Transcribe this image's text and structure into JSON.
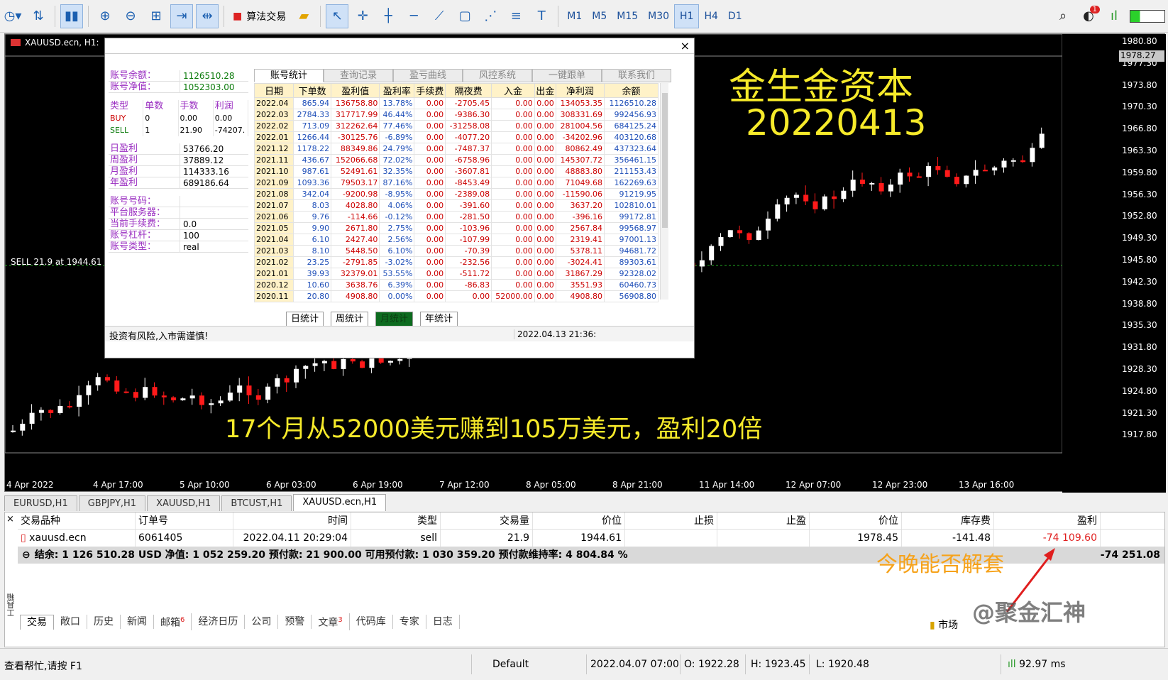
{
  "toolbar": {
    "algo_trading": "算法交易",
    "timeframes": [
      "M1",
      "M5",
      "M15",
      "M30",
      "H1",
      "H4",
      "D1"
    ],
    "active_timeframe": "H1",
    "notification_badge": "1"
  },
  "chart": {
    "title": "XAUUSD.ecn, H1:",
    "sell_line_label": "SELL 21.9 at 1944.61",
    "price_box": "1978.27",
    "y_ticks": [
      "1980.80",
      "1977.30",
      "1973.80",
      "1970.30",
      "1966.80",
      "1963.30",
      "1959.80",
      "1956.30",
      "1952.80",
      "1949.30",
      "1945.80",
      "1942.30",
      "1938.80",
      "1935.30",
      "1931.80",
      "1928.30",
      "1924.80",
      "1921.30",
      "1917.80"
    ],
    "x_ticks": [
      "4 Apr 2022",
      "4 Apr 17:00",
      "5 Apr 10:00",
      "6 Apr 03:00",
      "6 Apr 19:00",
      "7 Apr 12:00",
      "8 Apr 05:00",
      "8 Apr 21:00",
      "11 Apr 14:00",
      "12 Apr 07:00",
      "12 Apr 23:00",
      "13 Apr 16:00"
    ],
    "overlay_title": "金生金资本",
    "overlay_date": "20220413",
    "overlay_caption": "17个月从52000美元赚到105万美元，盈利20倍",
    "overlay_question": "今晚能否解套",
    "colors": {
      "bull": "#ffffff",
      "bear": "#ff1a1a",
      "sell_line": "#22aa22",
      "overlay": "#f6ea2a"
    }
  },
  "dialog": {
    "close": "×",
    "left": {
      "balance": {
        "label": "账号余额：",
        "value": "1126510.28"
      },
      "equity": {
        "label": "账号净值：",
        "value": "1052303.00"
      },
      "type_header": [
        "类型",
        "单数",
        "手数",
        "利润"
      ],
      "buy": [
        "BUY",
        "0",
        "0.00",
        "0.00"
      ],
      "sell": [
        "SELL",
        "1",
        "21.90",
        "-74207."
      ],
      "daily": {
        "label": "日盈利",
        "value": "53766.20"
      },
      "weekly": {
        "label": "周盈利",
        "value": "37889.12"
      },
      "monthly": {
        "label": "月盈利",
        "value": "114333.16"
      },
      "yearly": {
        "label": "年盈利",
        "value": "689186.64"
      },
      "acct_no": {
        "label": "账号号码：",
        "value": ""
      },
      "server": {
        "label": "平台服务器：",
        "value": ""
      },
      "fee": {
        "label": "当前手续费：",
        "value": "0.0"
      },
      "leverage": {
        "label": "账号杠杆：",
        "value": "100"
      },
      "acct_type": {
        "label": "账号类型：",
        "value": "real"
      }
    },
    "tabs": [
      "账号统计",
      "查询记录",
      "盈亏曲线",
      "风控系统",
      "一键跟单",
      "联系我们"
    ],
    "columns": [
      "日期",
      "下单数",
      "盈利值",
      "盈利率",
      "手续费",
      "隔夜费",
      "入金",
      "出金",
      "净利润",
      "余额"
    ],
    "rows": [
      [
        "2022.04",
        "865.94",
        "136758.80",
        "13.78%",
        "0.00",
        "-2705.45",
        "0.00",
        "0.00",
        "134053.35",
        "1126510.28"
      ],
      [
        "2022.03",
        "2784.33",
        "317717.99",
        "46.44%",
        "0.00",
        "-9386.30",
        "0.00",
        "0.00",
        "308331.69",
        "992456.93"
      ],
      [
        "2022.02",
        "713.09",
        "312262.64",
        "77.46%",
        "0.00",
        "-31258.08",
        "0.00",
        "0.00",
        "281004.56",
        "684125.24"
      ],
      [
        "2022.01",
        "1266.44",
        "-30125.76",
        "-6.89%",
        "0.00",
        "-4077.20",
        "0.00",
        "0.00",
        "-34202.96",
        "403120.68"
      ],
      [
        "2021.12",
        "1178.22",
        "88349.86",
        "24.79%",
        "0.00",
        "-7487.37",
        "0.00",
        "0.00",
        "80862.49",
        "437323.64"
      ],
      [
        "2021.11",
        "436.67",
        "152066.68",
        "72.02%",
        "0.00",
        "-6758.96",
        "0.00",
        "0.00",
        "145307.72",
        "356461.15"
      ],
      [
        "2021.10",
        "987.61",
        "52491.61",
        "32.35%",
        "0.00",
        "-3607.81",
        "0.00",
        "0.00",
        "48883.80",
        "211153.43"
      ],
      [
        "2021.09",
        "1093.36",
        "79503.17",
        "87.16%",
        "0.00",
        "-8453.49",
        "0.00",
        "0.00",
        "71049.68",
        "162269.63"
      ],
      [
        "2021.08",
        "342.04",
        "-9200.98",
        "-8.95%",
        "0.00",
        "-2389.08",
        "0.00",
        "0.00",
        "-11590.06",
        "91219.95"
      ],
      [
        "2021.07",
        "8.03",
        "4028.80",
        "4.06%",
        "0.00",
        "-391.60",
        "0.00",
        "0.00",
        "3637.20",
        "102810.01"
      ],
      [
        "2021.06",
        "9.76",
        "-114.66",
        "-0.12%",
        "0.00",
        "-281.50",
        "0.00",
        "0.00",
        "-396.16",
        "99172.81"
      ],
      [
        "2021.05",
        "9.90",
        "2671.80",
        "2.75%",
        "0.00",
        "-103.96",
        "0.00",
        "0.00",
        "2567.84",
        "99568.97"
      ],
      [
        "2021.04",
        "6.10",
        "2427.40",
        "2.56%",
        "0.00",
        "-107.99",
        "0.00",
        "0.00",
        "2319.41",
        "97001.13"
      ],
      [
        "2021.03",
        "8.10",
        "5448.50",
        "6.10%",
        "0.00",
        "-70.39",
        "0.00",
        "0.00",
        "5378.11",
        "94681.72"
      ],
      [
        "2021.02",
        "23.25",
        "-2791.85",
        "-3.02%",
        "0.00",
        "-232.56",
        "0.00",
        "0.00",
        "-3024.41",
        "89303.61"
      ],
      [
        "2021.01",
        "39.93",
        "32379.01",
        "53.55%",
        "0.00",
        "-511.72",
        "0.00",
        "0.00",
        "31867.29",
        "92328.02"
      ],
      [
        "2020.12",
        "10.60",
        "3638.76",
        "6.39%",
        "0.00",
        "-86.83",
        "0.00",
        "0.00",
        "3551.93",
        "60460.73"
      ],
      [
        "2020.11",
        "20.80",
        "4908.80",
        "0.00%",
        "0.00",
        "0.00",
        "52000.00",
        "0.00",
        "4908.80",
        "56908.80"
      ]
    ],
    "buttons": [
      "日统计",
      "周统计",
      "月统计",
      "年统计"
    ],
    "active_button": "月统计",
    "risk_notice": "投资有风险,入市需谨慎!",
    "timestamp": "2022.04.13 21:36:"
  },
  "chart_tabs": [
    "EURUSD,H1",
    "GBPJPY,H1",
    "XAUUSD,H1",
    "BTCUST,H1",
    "XAUUSD.ecn,H1"
  ],
  "active_chart_tab": "XAUUSD.ecn,H1",
  "terminal": {
    "headers": [
      "交易品种",
      "订单号",
      "时间",
      "类型",
      "交易量",
      "价位",
      "止损",
      "止盈",
      "价位",
      "库存费",
      "盈利"
    ],
    "position": [
      "xauusd.ecn",
      "6061405",
      "2022.04.11 20:29:04",
      "sell",
      "21.9",
      "1944.61",
      "",
      "",
      "1978.45",
      "-141.48",
      "-74 109.60"
    ],
    "summary": "结余: 1 126 510.28 USD  净值: 1 052 259.20  预付款: 21 900.00  可用预付款: 1 030 359.20  预付款维持率: 4 804.84 %",
    "summary_total": "-74 251.08",
    "side_label": "工具箱",
    "bottom_tabs": [
      {
        "label": "交易",
        "badge": ""
      },
      {
        "label": "敞口",
        "badge": ""
      },
      {
        "label": "历史",
        "badge": ""
      },
      {
        "label": "新闻",
        "badge": ""
      },
      {
        "label": "邮箱",
        "badge": "6"
      },
      {
        "label": "经济日历",
        "badge": ""
      },
      {
        "label": "公司",
        "badge": ""
      },
      {
        "label": "预警",
        "badge": ""
      },
      {
        "label": "文章",
        "badge": "3"
      },
      {
        "label": "代码库",
        "badge": ""
      },
      {
        "label": "专家",
        "badge": ""
      },
      {
        "label": "日志",
        "badge": ""
      }
    ],
    "market_label": "市场",
    "watermark": "@聚金汇神"
  },
  "status": {
    "help": "查看帮忙,请按 F1",
    "profile": "Default",
    "datetime": "2022.04.07 07:00",
    "open": "O: 1922.28",
    "high": "H: 1923.45",
    "low": "L: 1920.48",
    "ping": "92.97 ms"
  }
}
